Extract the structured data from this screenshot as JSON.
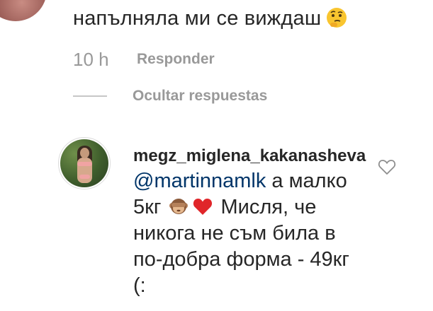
{
  "top_comment": {
    "text": "напълняла ми се виждаш",
    "emoji": "thinking-face"
  },
  "meta": {
    "time": "10 h",
    "reply_label": "Responder"
  },
  "thread": {
    "hide_replies_label": "Ocultar respuestas"
  },
  "reply": {
    "username": "megz_miglena_kakanasheva",
    "mention": "@martinnamlk",
    "text_1": " а малко",
    "text_2": "5кг ",
    "emoji_1": "see-no-evil-monkey",
    "emoji_2": "red-heart",
    "text_3": " Мисля, че",
    "line_3": "никога не съм била в",
    "line_4": "по-добра форма - 49кг",
    "line_5": "(:"
  },
  "colors": {
    "text": "#262626",
    "muted": "#999999",
    "mention": "#003569",
    "heart": "#ed4956"
  },
  "icons": {
    "like": "heart-outline-icon"
  }
}
